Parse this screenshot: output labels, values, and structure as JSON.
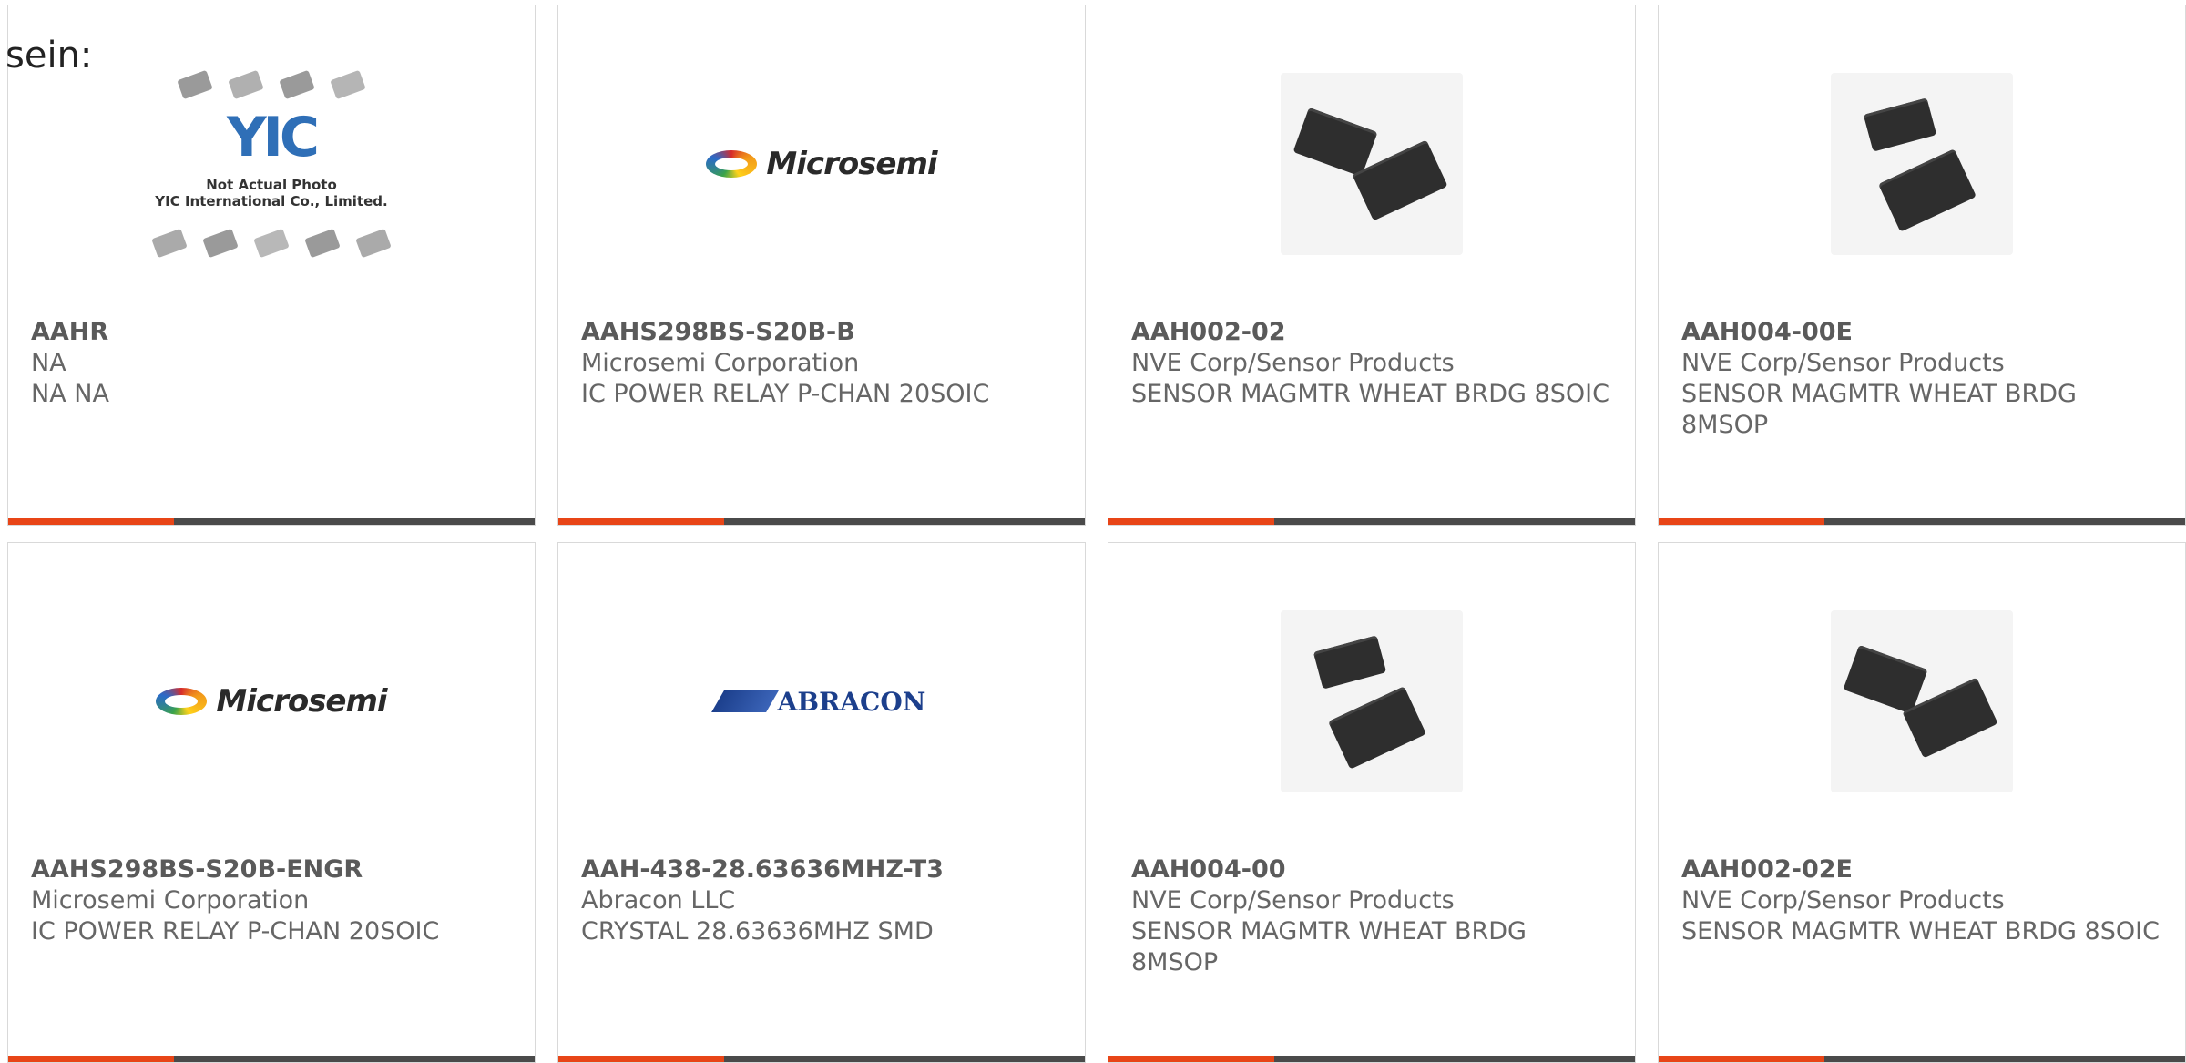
{
  "lead_text": "sein:",
  "colors": {
    "accent": "#e84517",
    "bar": "#4a4a4a",
    "border": "#d9d9d9"
  },
  "placeholder": {
    "caption_line1": "Not Actual Photo",
    "caption_line2": "YIC International Co., Limited.",
    "brand": "YIC"
  },
  "logos": {
    "microsemi": "Microsemi",
    "abracon": "ABRACON"
  },
  "products": [
    {
      "part": "AAHR",
      "manufacturer": "NA",
      "description": "NA NA",
      "image": "placeholder"
    },
    {
      "part": "AAHS298BS-S20B-B",
      "manufacturer": "Microsemi Corporation",
      "description": "IC POWER RELAY P-CHAN 20SOIC",
      "image": "microsemi-logo"
    },
    {
      "part": "AAH002-02",
      "manufacturer": "NVE Corp/Sensor Products",
      "description": "SENSOR MAGMTR WHEAT BRDG 8SOIC",
      "image": "soic-chips"
    },
    {
      "part": "AAH004-00E",
      "manufacturer": "NVE Corp/Sensor Products",
      "description": "SENSOR MAGMTR WHEAT BRDG 8MSOP",
      "image": "msop-chips"
    },
    {
      "part": "AAHS298BS-S20B-ENGR",
      "manufacturer": "Microsemi Corporation",
      "description": "IC POWER RELAY P-CHAN 20SOIC",
      "image": "microsemi-logo"
    },
    {
      "part": "AAH-438-28.63636MHZ-T3",
      "manufacturer": "Abracon LLC",
      "description": "CRYSTAL 28.63636MHZ SMD",
      "image": "abracon-logo"
    },
    {
      "part": "AAH004-00",
      "manufacturer": "NVE Corp/Sensor Products",
      "description": "SENSOR MAGMTR WHEAT BRDG 8MSOP",
      "image": "msop-chips"
    },
    {
      "part": "AAH002-02E",
      "manufacturer": "NVE Corp/Sensor Products",
      "description": "SENSOR MAGMTR WHEAT BRDG 8SOIC",
      "image": "soic-chips"
    }
  ]
}
